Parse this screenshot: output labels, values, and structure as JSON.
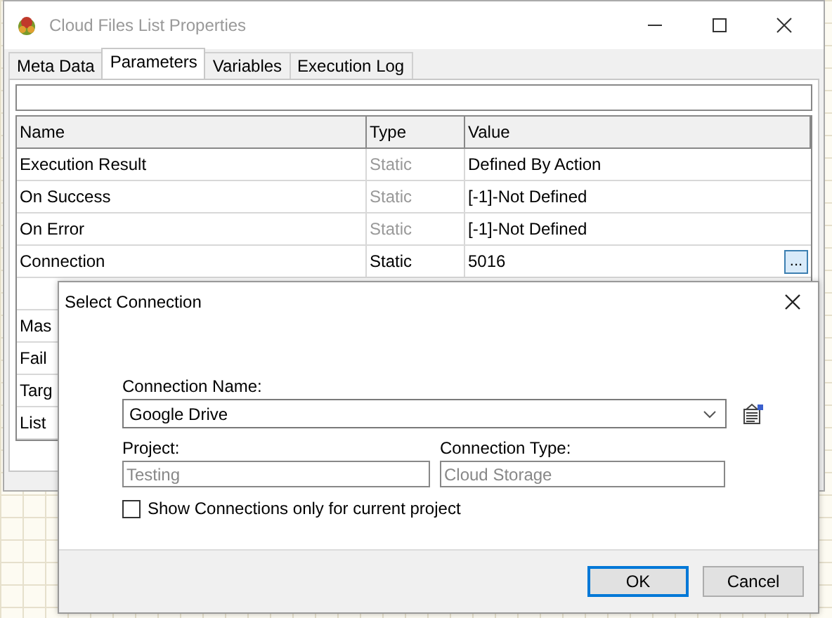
{
  "window": {
    "title": "Cloud Files List Properties"
  },
  "tabs": [
    {
      "label": "Meta Data",
      "selected": false
    },
    {
      "label": "Parameters",
      "selected": true
    },
    {
      "label": "Variables",
      "selected": false
    },
    {
      "label": "Execution Log",
      "selected": false
    }
  ],
  "table": {
    "columns": [
      "Name",
      "Type",
      "Value"
    ],
    "rows": [
      {
        "name": "Execution Result",
        "type": "Static",
        "type_dimmed": true,
        "value": "Defined By Action"
      },
      {
        "name": "On Success",
        "type": "Static",
        "type_dimmed": true,
        "value": "[-1]-Not Defined"
      },
      {
        "name": "On Error",
        "type": "Static",
        "type_dimmed": true,
        "value": "[-1]-Not Defined"
      },
      {
        "name": "Connection",
        "type": "Static",
        "type_dimmed": false,
        "value": "5016",
        "button": "..."
      },
      {
        "name": "Mas",
        "kind": "partial"
      },
      {
        "name": "Fail",
        "kind": "partial"
      },
      {
        "name": "Targ",
        "kind": "partial"
      },
      {
        "name": "List",
        "kind": "partial"
      }
    ]
  },
  "dialog": {
    "title": "Select Connection",
    "connection_name": {
      "label": "Connection Name:",
      "value": "Google Drive"
    },
    "project": {
      "label": "Project:",
      "value": "Testing",
      "disabled": true
    },
    "connection_type": {
      "label": "Connection Type:",
      "value": "Cloud Storage",
      "disabled": true
    },
    "checkbox": {
      "label": "Show Connections only for current project",
      "checked": false
    },
    "buttons": [
      {
        "label": "OK",
        "focused": true
      },
      {
        "label": "Cancel",
        "focused": false
      }
    ]
  }
}
